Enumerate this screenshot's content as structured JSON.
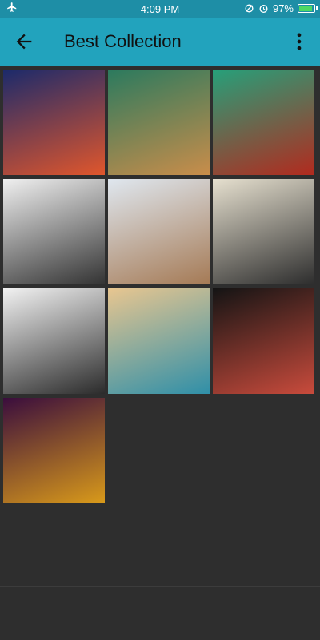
{
  "status_bar": {
    "time": "4:09 PM",
    "battery": "97%",
    "battery_level": 0.97
  },
  "app_bar": {
    "title": "Best Collection",
    "back_icon": "arrow-left-icon",
    "menu_icon": "more-vert-icon"
  },
  "gallery": {
    "items": [
      {
        "name": "wallpaper-cosmic-explorer",
        "colors": [
          "#1b2a6b",
          "#e0562c"
        ]
      },
      {
        "name": "wallpaper-aurora-village",
        "colors": [
          "#2b7a5e",
          "#c98d4a"
        ]
      },
      {
        "name": "wallpaper-red-landscape",
        "colors": [
          "#26a07a",
          "#b22a1e"
        ]
      },
      {
        "name": "wallpaper-shattered-zebra",
        "colors": [
          "#f0f0f0",
          "#333333"
        ]
      },
      {
        "name": "wallpaper-camel-taj-mahal",
        "colors": [
          "#dfe7ef",
          "#a57a55"
        ]
      },
      {
        "name": "wallpaper-astronaut-skull",
        "colors": [
          "#e6e0cf",
          "#2d2d2d"
        ]
      },
      {
        "name": "wallpaper-zebra-explosion",
        "colors": [
          "#f2f2f2",
          "#2b2b2b"
        ]
      },
      {
        "name": "wallpaper-glass-ocean",
        "colors": [
          "#e8c690",
          "#2f8fa8"
        ]
      },
      {
        "name": "wallpaper-space-mountains",
        "colors": [
          "#141414",
          "#c94b3c"
        ]
      },
      {
        "name": "wallpaper-golden-predator",
        "colors": [
          "#3a0d3d",
          "#d99a1a"
        ]
      }
    ]
  }
}
